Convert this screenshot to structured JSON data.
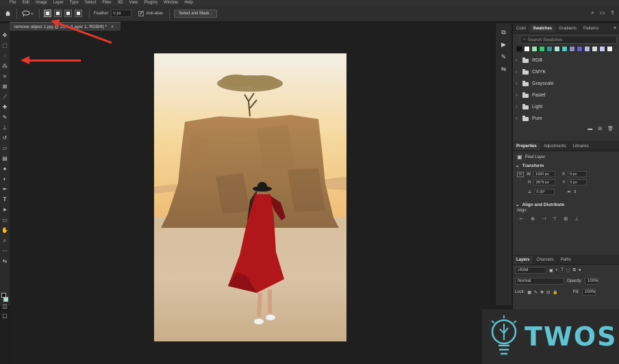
{
  "menu": [
    "File",
    "Edit",
    "Image",
    "Layer",
    "Type",
    "Select",
    "Filter",
    "3D",
    "View",
    "Plugins",
    "Window",
    "Help"
  ],
  "options_bar": {
    "feather_label": "Feather:",
    "feather_value": "0 px",
    "antialias_label": "Anti-alias",
    "select_mask_label": "Select and Mask..."
  },
  "document_tab": {
    "title": "remove object 1.jpg @ 25% (Layer 1, RGB/8) *",
    "close": "×"
  },
  "swatches_panel": {
    "tabs": [
      "Color",
      "Swatches",
      "Gradients",
      "Patterns"
    ],
    "active_tab": "Swatches",
    "search_placeholder": "Search Swatches",
    "recent_colors": [
      "#111111",
      "#ffffff",
      "#9ae6b4",
      "#2ecc71",
      "#2a9d8f",
      "#b4e5d6",
      "#4cc9c0",
      "#8a8fbf",
      "#6b5bd6",
      "#b8b8ec",
      "#dcdce0",
      "#c8c8f0",
      "#eeeeee"
    ],
    "groups": [
      "RGB",
      "CMYK",
      "Grayscale",
      "Pastel",
      "Light",
      "Pure"
    ]
  },
  "properties_panel": {
    "tabs": [
      "Properties",
      "Adjustments",
      "Libraries"
    ],
    "active_tab": "Properties",
    "layer_type": "Pixel Layer",
    "transform_title": "Transform",
    "w_label": "W",
    "w_value": "1920 px",
    "h_label": "H",
    "h_value": "2879 px",
    "x_label": "X",
    "x_value": "0 px",
    "y_label": "Y",
    "y_value": "0 px",
    "angle_value": "0.00°",
    "align_title": "Align and Distribute",
    "align_label": "Align:"
  },
  "layers_panel": {
    "tabs": [
      "Layers",
      "Channels",
      "Paths"
    ],
    "active_tab": "Layers",
    "kind_label": "Kind",
    "blend_mode": "Normal",
    "opacity_label": "Opacity:",
    "opacity_value": "100%",
    "lock_label": "Lock:",
    "fill_label": "Fill:",
    "fill_value": "100%"
  },
  "watermark": {
    "text": "TWOS"
  },
  "colors": {
    "arrow": "#e8372b",
    "watermark": "#5fc4d3",
    "dress": "#b0161a"
  }
}
